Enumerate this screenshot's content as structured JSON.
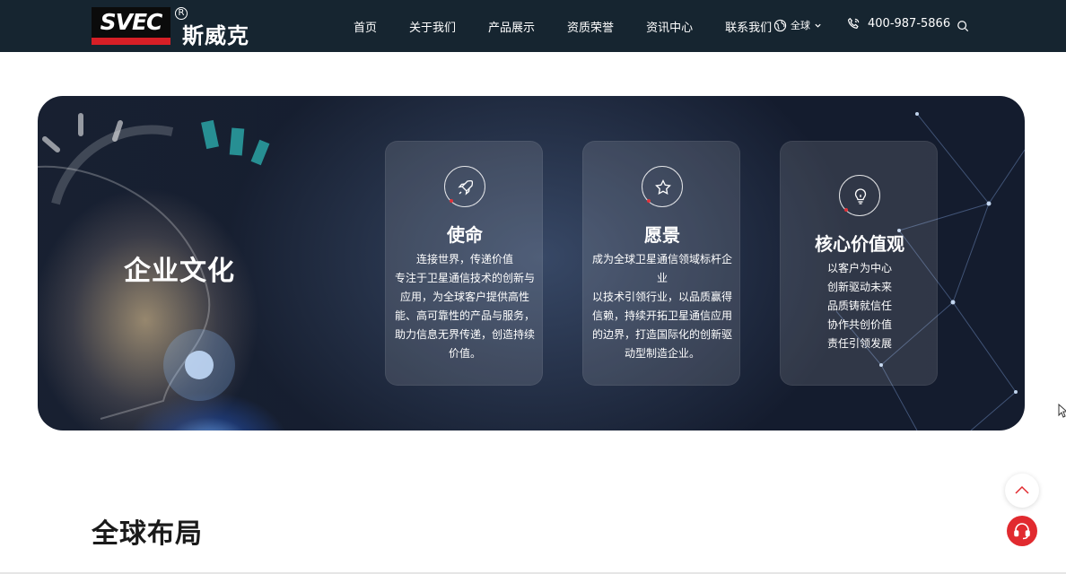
{
  "header": {
    "logo_text": "SVEC",
    "logo_reg": "R",
    "brand_name": "斯威克",
    "nav": [
      "首页",
      "关于我们",
      "产品展示",
      "资质荣誉",
      "资讯中心",
      "联系我们"
    ],
    "region_label": "全球",
    "phone": "400-987-5866"
  },
  "culture": {
    "title": "企业文化",
    "cards": [
      {
        "icon": "rocket-icon",
        "title": "使命",
        "lines": [
          "连接世界，传递价值",
          "专注于卫星通信技术的创新与应用，为全球客户提供高性能、高可靠性的产品与服务，助力信息无界传递，创造持续价值。"
        ]
      },
      {
        "icon": "star-icon",
        "title": "愿景",
        "lines": [
          "成为全球卫星通信领域标杆企业",
          "以技术引领行业，以品质赢得信赖，持续开拓卫星通信应用的边界，打造国际化的创新驱动型制造企业。"
        ]
      },
      {
        "icon": "lightbulb-icon",
        "title": "核心价值观",
        "lines": [
          "以客户为中心",
          "创新驱动未来",
          "品质铸就信任",
          "协作共创价值",
          "责任引领发展"
        ]
      }
    ]
  },
  "global": {
    "title": "全球布局"
  },
  "colors": {
    "header_bg": "#162530",
    "accent_red": "#e12a2f"
  }
}
